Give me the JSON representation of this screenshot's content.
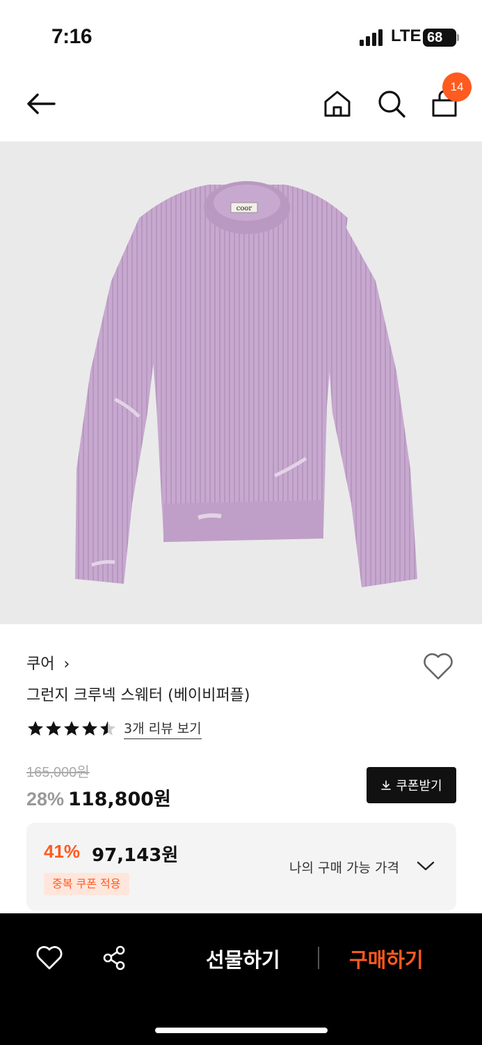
{
  "status": {
    "time": "7:16",
    "network": "LTE",
    "battery": "68"
  },
  "nav": {
    "back_icon": "arrow-left-icon",
    "home_icon": "home-icon",
    "search_icon": "search-icon",
    "cart_icon": "shopping-bag-icon",
    "cart_count": "14"
  },
  "product": {
    "image_label": "coor",
    "brand": "쿠어",
    "brand_chevron": "›",
    "name": "그런지 크루넥 스웨터 (베이비퍼플)",
    "rating": 4.5,
    "review_link": "3개 리뷰 보기",
    "original_price": "165,000원",
    "discount_rate": "28%",
    "sale_price": "118,800원",
    "coupon_button": "쿠폰받기",
    "colors": {
      "sweater": "#c7a8cf",
      "accent": "#ff5a1f"
    }
  },
  "best_price": {
    "rate": "41%",
    "price": "97,143원",
    "badge": "중복 쿠폰 적용",
    "label": "나의 구매 가능 가격"
  },
  "bottom_bar": {
    "heart_icon": "heart-outline-icon",
    "share_icon": "share-icon",
    "gift_label": "선물하기",
    "buy_label": "구매하기"
  }
}
